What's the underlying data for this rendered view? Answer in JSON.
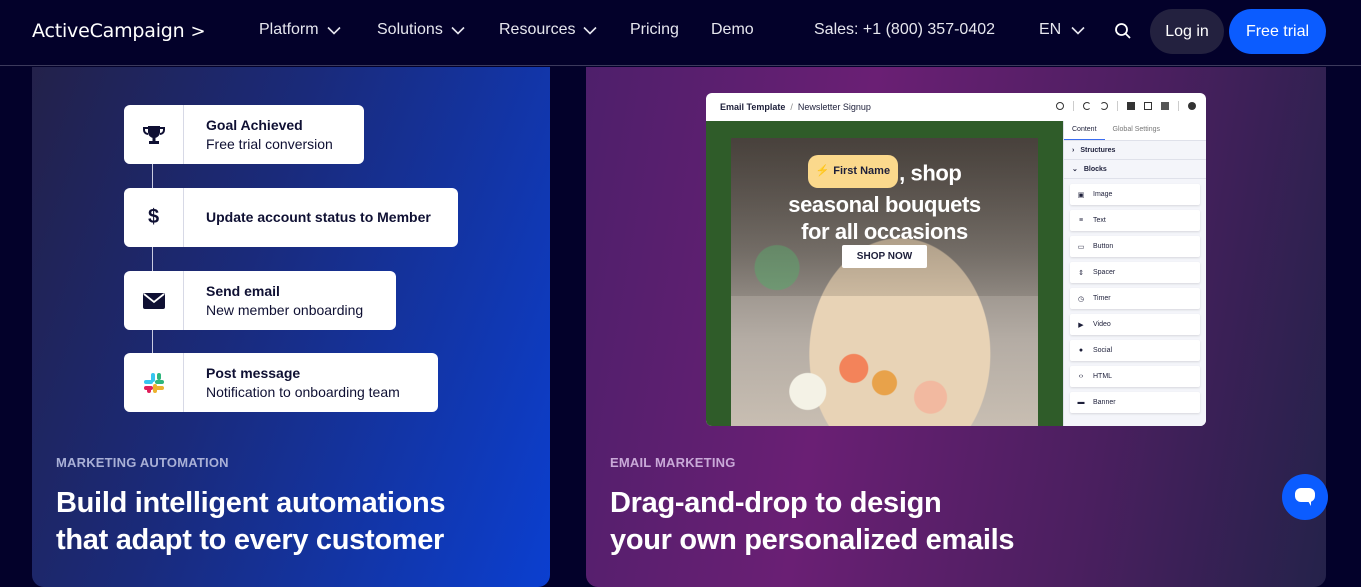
{
  "nav": {
    "logo": "ActiveCampaign",
    "logo_mark": ">",
    "items": [
      {
        "label": "Platform",
        "has_dropdown": true
      },
      {
        "label": "Solutions",
        "has_dropdown": true
      },
      {
        "label": "Resources",
        "has_dropdown": true
      },
      {
        "label": "Pricing",
        "has_dropdown": false
      },
      {
        "label": "Demo",
        "has_dropdown": false
      }
    ],
    "sales": "Sales: +1 (800) 357-0402",
    "language": "EN",
    "login": "Log in",
    "free_trial": "Free trial"
  },
  "automation_card": {
    "eyebrow": "MARKETING AUTOMATION",
    "headline_line1": "Build intelligent automations",
    "headline_line2": "that adapt to every customer",
    "steps": [
      {
        "icon": "trophy-icon",
        "title": "Goal Achieved",
        "subtitle": "Free trial conversion"
      },
      {
        "icon": "dollar-icon",
        "title": "Update account status to Member",
        "subtitle": ""
      },
      {
        "icon": "envelope-icon",
        "title": "Send email",
        "subtitle": "New member onboarding"
      },
      {
        "icon": "slack-icon",
        "title": "Post message",
        "subtitle": "Notification to onboarding team"
      }
    ]
  },
  "email_card": {
    "eyebrow": "EMAIL MARKETING",
    "headline_line1": "Drag-and-drop to design",
    "headline_line2": "your own personalized emails",
    "editor": {
      "breadcrumb_root": "Email Template",
      "breadcrumb_sep": "/",
      "breadcrumb_page": "Newsletter Signup",
      "tabs": [
        "Content",
        "Global Settings"
      ],
      "sections": [
        {
          "label": "Structures",
          "state": "collapsed"
        },
        {
          "label": "Blocks",
          "state": "expanded"
        }
      ],
      "blocks": [
        {
          "icon": "image-icon",
          "label": "Image"
        },
        {
          "icon": "text-icon",
          "label": "Text"
        },
        {
          "icon": "button-icon",
          "label": "Button"
        },
        {
          "icon": "spacer-icon",
          "label": "Spacer"
        },
        {
          "icon": "timer-icon",
          "label": "Timer"
        },
        {
          "icon": "video-icon",
          "label": "Video"
        },
        {
          "icon": "social-icon",
          "label": "Social"
        },
        {
          "icon": "html-icon",
          "label": "HTML"
        },
        {
          "icon": "banner-icon",
          "label": "Banner"
        }
      ],
      "hero": {
        "personalization_tag": "First Name",
        "text_after_tag": ", shop",
        "line2": "seasonal bouquets",
        "line3": "for all occasions",
        "cta": "SHOP NOW"
      }
    }
  },
  "colors": {
    "brand_blue": "#0b5cff",
    "nav_bg": "#03012a",
    "tag_yellow": "#fbd98c",
    "email_green": "#2f5c29"
  }
}
